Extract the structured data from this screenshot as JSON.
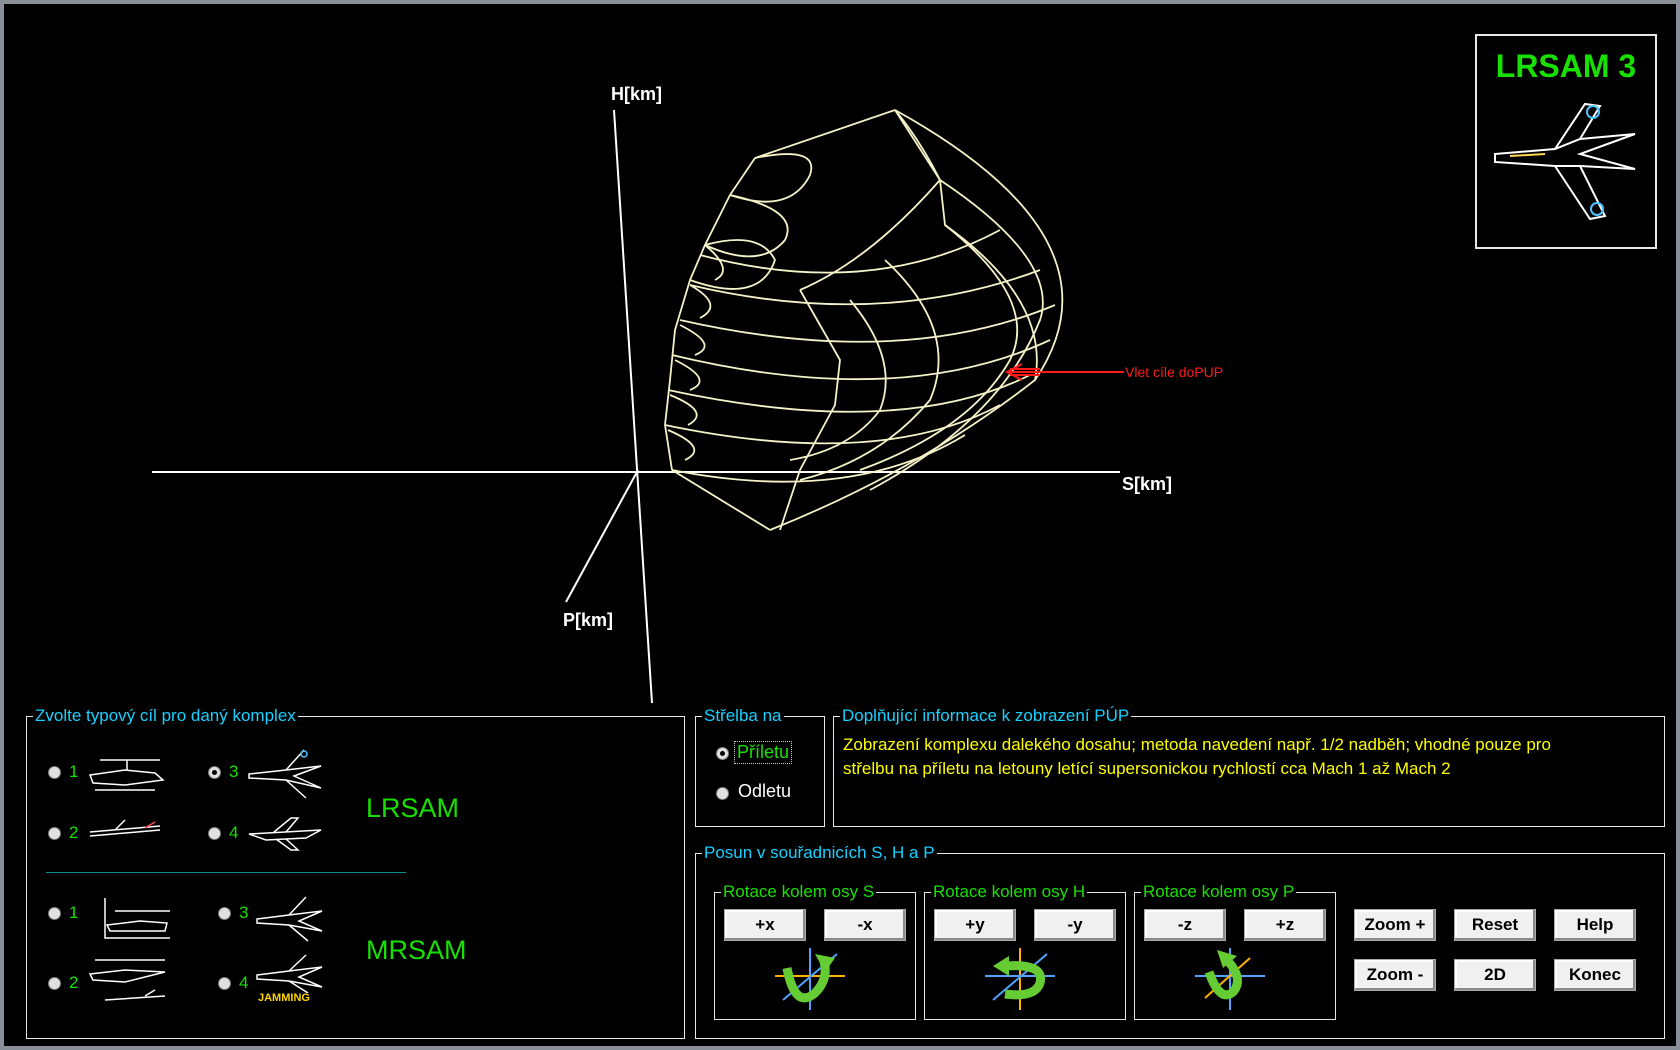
{
  "plot": {
    "axis_h": "H[km]",
    "axis_s": "S[km]",
    "axis_p": "P[km]",
    "annotation": "Vlet cíle doPUP",
    "annotation_color": "#ff1a1a",
    "wire_color": "#f5f2c8"
  },
  "logo": {
    "title": "LRSAM 3"
  },
  "target_select": {
    "legend": "Zvolte typový cíl pro daný komplex",
    "lrsam": {
      "label": "LRSAM",
      "options": [
        {
          "num": "1",
          "icon": "helicopter-icon"
        },
        {
          "num": "3",
          "icon": "fighter-jet-icon",
          "selected": true
        },
        {
          "num": "2",
          "icon": "cruise-missile-icon"
        },
        {
          "num": "4",
          "icon": "bomber-icon"
        }
      ]
    },
    "mrsam": {
      "label": "MRSAM",
      "options": [
        {
          "num": "1",
          "icon": "helicopter-icon"
        },
        {
          "num": "3",
          "icon": "fighter-jet-icon"
        },
        {
          "num": "2",
          "icon": "helicopter-missile-icon"
        },
        {
          "num": "4",
          "icon": "jamming-fighter-icon",
          "caption": "JAMMING"
        }
      ]
    }
  },
  "fire_mode": {
    "legend": "Střelba na",
    "options": [
      {
        "label": "Příletu",
        "selected": true
      },
      {
        "label": "Odletu",
        "selected": false
      }
    ]
  },
  "info": {
    "legend": "Doplňující informace k zobrazení PÚP",
    "line1": "Zobrazení komplexu dalekého dosahu; metoda navedení např. 1/2 nadběh; vhodné pouze pro",
    "line2": "střelbu na příletu na letouny letící supersonickou rychlostí cca Mach 1 až Mach 2"
  },
  "shift": {
    "legend": "Posun v souřadnicích S, H a P",
    "rot_s": {
      "legend": "Rotace kolem osy S",
      "b1": "+x",
      "b2": "-x",
      "icon": "rotate-s-icon"
    },
    "rot_h": {
      "legend": "Rotace kolem osy H",
      "b1": "+y",
      "b2": "-y",
      "icon": "rotate-h-icon"
    },
    "rot_p": {
      "legend": "Rotace kolem osy P",
      "b1": "-z",
      "b2": "+z",
      "icon": "rotate-p-icon"
    },
    "zoom_in": "Zoom +",
    "reset": "Reset",
    "help": "Help",
    "zoom_out": "Zoom -",
    "mode_2d": "2D",
    "exit": "Konec"
  }
}
